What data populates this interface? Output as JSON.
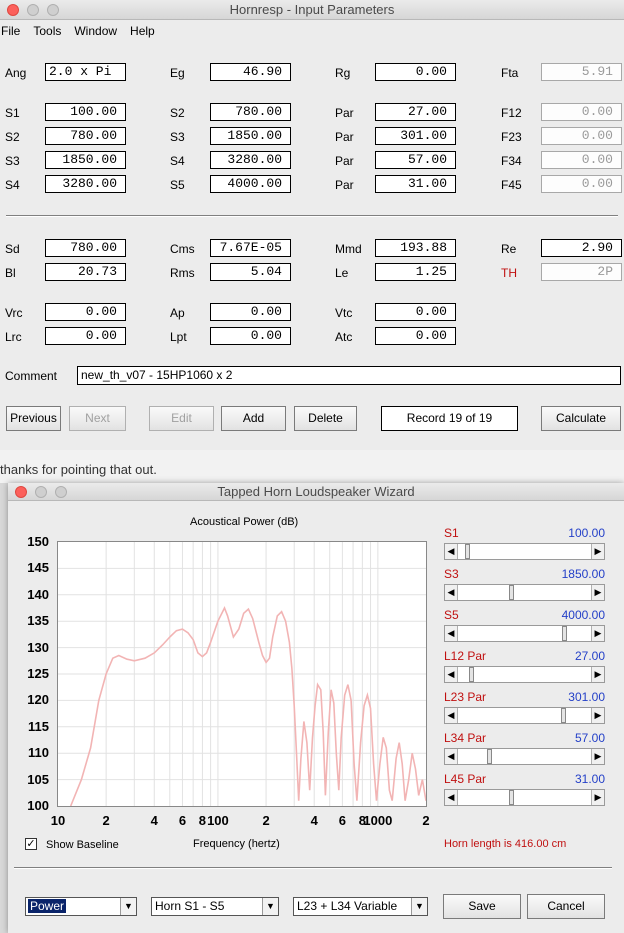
{
  "window1": {
    "title": "Hornresp - Input Parameters",
    "menu": [
      "File",
      "Tools",
      "Window",
      "Help"
    ],
    "rows": [
      {
        "fields": [
          {
            "label": "Ang",
            "value": "2.0 x Pi"
          },
          {
            "label": "Eg",
            "value": "46.90"
          },
          {
            "label": "Rg",
            "value": "0.00"
          },
          {
            "label": "Fta",
            "value": "5.91"
          }
        ]
      },
      {
        "fields": [
          {
            "label": "S1",
            "value": "100.00"
          },
          {
            "label": "S2",
            "value": "780.00"
          },
          {
            "label": "Par",
            "value": "27.00"
          },
          {
            "label": "F12",
            "value": "0.00"
          }
        ]
      },
      {
        "fields": [
          {
            "label": "S2",
            "value": "780.00"
          },
          {
            "label": "S3",
            "value": "1850.00"
          },
          {
            "label": "Par",
            "value": "301.00"
          },
          {
            "label": "F23",
            "value": "0.00"
          }
        ]
      },
      {
        "fields": [
          {
            "label": "S3",
            "value": "1850.00"
          },
          {
            "label": "S4",
            "value": "3280.00"
          },
          {
            "label": "Par",
            "value": "57.00"
          },
          {
            "label": "F34",
            "value": "0.00"
          }
        ]
      },
      {
        "fields": [
          {
            "label": "S4",
            "value": "3280.00"
          },
          {
            "label": "S5",
            "value": "4000.00"
          },
          {
            "label": "Par",
            "value": "31.00"
          },
          {
            "label": "F45",
            "value": "0.00"
          }
        ]
      },
      {
        "fields": [
          {
            "label": "Sd",
            "value": "780.00"
          },
          {
            "label": "Cms",
            "value": "7.67E-05"
          },
          {
            "label": "Mmd",
            "value": "193.88"
          },
          {
            "label": "Re",
            "value": "2.90"
          }
        ]
      },
      {
        "fields": [
          {
            "label": "Bl",
            "value": "20.73"
          },
          {
            "label": "Rms",
            "value": "5.04"
          },
          {
            "label": "Le",
            "value": "1.25"
          },
          {
            "label": "TH",
            "value": "2P"
          }
        ]
      },
      {
        "fields": [
          {
            "label": "Vrc",
            "value": "0.00"
          },
          {
            "label": "Ap",
            "value": "0.00"
          },
          {
            "label": "Vtc",
            "value": "0.00"
          }
        ]
      },
      {
        "fields": [
          {
            "label": "Lrc",
            "value": "0.00"
          },
          {
            "label": "Lpt",
            "value": "0.00"
          },
          {
            "label": "Atc",
            "value": "0.00"
          }
        ]
      }
    ],
    "comment_label": "Comment",
    "comment_value": "new_th_v07 - 15HP1060 x 2",
    "buttons": {
      "previous": "Previous",
      "next": "Next",
      "edit": "Edit",
      "add": "Add",
      "delete": "Delete",
      "record": "Record 19 of 19",
      "calculate": "Calculate"
    }
  },
  "background_text": "thanks for pointing that out.",
  "window2": {
    "title": "Tapped Horn Loudspeaker Wizard",
    "chart_title": "Acoustical Power (dB)",
    "x_axis_label": "Frequency (hertz)",
    "show_baseline_label": "Show Baseline",
    "show_baseline_checked": true,
    "horn_length": "Horn length is 416.00 cm",
    "sliders": [
      {
        "label": "S1",
        "value": "100.00",
        "position": 0.05
      },
      {
        "label": "S3",
        "value": "1850.00",
        "position": 0.4
      },
      {
        "label": "S5",
        "value": "4000.00",
        "position": 0.82
      },
      {
        "label": "L12  Par",
        "value": "27.00",
        "position": 0.08
      },
      {
        "label": "L23  Par",
        "value": "301.00",
        "position": 0.81
      },
      {
        "label": "L34  Par",
        "value": "57.00",
        "position": 0.22
      },
      {
        "label": "L45  Par",
        "value": "31.00",
        "position": 0.4
      }
    ],
    "combos": {
      "mode": "Power",
      "horn": "Horn S1 - S5",
      "variable": "L23 + L34 Variable"
    },
    "save_label": "Save",
    "cancel_label": "Cancel"
  },
  "chart_data": {
    "type": "line",
    "title": "Acoustical Power (dB)",
    "xlabel": "Frequency (hertz)",
    "ylabel": "",
    "x_scale": "log",
    "xlim": [
      10,
      2000
    ],
    "ylim": [
      100,
      150
    ],
    "y_ticks": [
      "150",
      "145",
      "140",
      "135",
      "130",
      "125",
      "120",
      "115",
      "110",
      "105",
      "100"
    ],
    "x_tick_labels": [
      {
        "f": 10,
        "t": "10"
      },
      {
        "f": 20,
        "t": "2"
      },
      {
        "f": 40,
        "t": "4"
      },
      {
        "f": 60,
        "t": "6"
      },
      {
        "f": 80,
        "t": "8"
      },
      {
        "f": 100,
        "t": "100"
      },
      {
        "f": 200,
        "t": "2"
      },
      {
        "f": 400,
        "t": "4"
      },
      {
        "f": 600,
        "t": "6"
      },
      {
        "f": 800,
        "t": "8"
      },
      {
        "f": 1000,
        "t": "1000"
      },
      {
        "f": 2000,
        "t": "2"
      }
    ],
    "grid": true,
    "series": [
      {
        "color": "#f2b4b4",
        "points": [
          [
            12,
            100
          ],
          [
            14,
            105
          ],
          [
            16,
            111
          ],
          [
            18,
            120
          ],
          [
            20,
            125
          ],
          [
            22,
            128
          ],
          [
            24,
            128.5
          ],
          [
            27,
            127.8
          ],
          [
            30,
            127.5
          ],
          [
            35,
            128
          ],
          [
            40,
            129
          ],
          [
            45,
            130.5
          ],
          [
            50,
            132
          ],
          [
            55,
            133.2
          ],
          [
            60,
            133.5
          ],
          [
            65,
            132.8
          ],
          [
            70,
            131.5
          ],
          [
            75,
            129
          ],
          [
            80,
            128.3
          ],
          [
            85,
            129
          ],
          [
            90,
            131
          ],
          [
            100,
            135
          ],
          [
            110,
            137.5
          ],
          [
            115,
            136
          ],
          [
            125,
            132
          ],
          [
            135,
            133.5
          ],
          [
            145,
            136.5
          ],
          [
            155,
            137.3
          ],
          [
            165,
            135.5
          ],
          [
            180,
            131
          ],
          [
            190,
            128.5
          ],
          [
            200,
            127.2
          ],
          [
            210,
            128
          ],
          [
            220,
            132
          ],
          [
            235,
            136
          ],
          [
            250,
            136.8
          ],
          [
            265,
            135
          ],
          [
            280,
            131
          ],
          [
            290,
            126
          ],
          [
            300,
            119
          ],
          [
            310,
            110
          ],
          [
            320,
            101
          ],
          [
            330,
            109
          ],
          [
            345,
            116
          ],
          [
            360,
            112
          ],
          [
            375,
            103
          ],
          [
            390,
            113
          ],
          [
            405,
            119
          ],
          [
            420,
            123
          ],
          [
            440,
            122
          ],
          [
            455,
            114
          ],
          [
            470,
            102
          ],
          [
            490,
            114
          ],
          [
            510,
            122
          ],
          [
            530,
            119.5
          ],
          [
            550,
            110
          ],
          [
            570,
            103
          ],
          [
            590,
            113
          ],
          [
            620,
            121
          ],
          [
            650,
            123
          ],
          [
            680,
            120
          ],
          [
            710,
            108
          ],
          [
            740,
            101
          ],
          [
            780,
            112
          ],
          [
            820,
            119
          ],
          [
            860,
            121
          ],
          [
            900,
            118.5
          ],
          [
            940,
            108
          ],
          [
            980,
            101
          ],
          [
            1030,
            108
          ],
          [
            1080,
            113
          ],
          [
            1130,
            111
          ],
          [
            1180,
            103
          ],
          [
            1230,
            101
          ],
          [
            1300,
            109
          ],
          [
            1360,
            112
          ],
          [
            1420,
            108
          ],
          [
            1480,
            101
          ],
          [
            1560,
            105
          ],
          [
            1640,
            110
          ],
          [
            1720,
            107
          ],
          [
            1800,
            102
          ],
          [
            1900,
            105
          ],
          [
            2000,
            101
          ]
        ]
      }
    ]
  }
}
